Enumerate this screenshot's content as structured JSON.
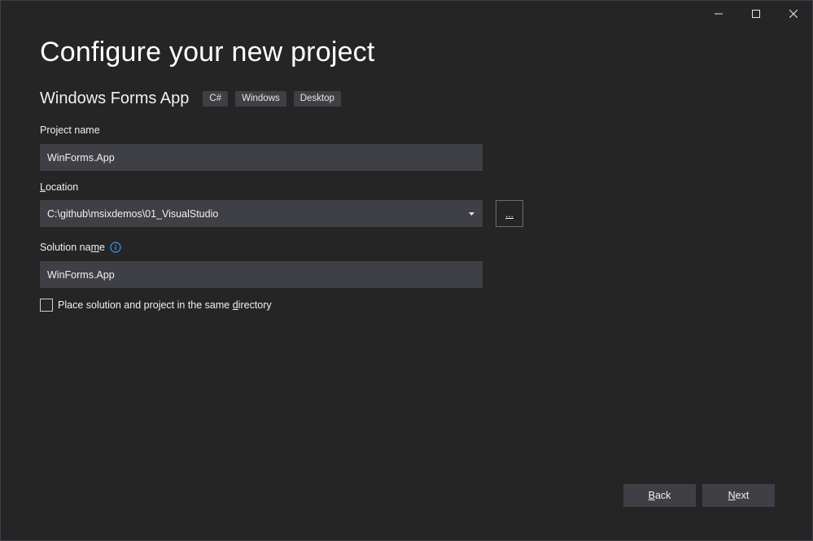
{
  "window": {
    "controls": [
      "minimize",
      "maximize",
      "close"
    ]
  },
  "header": {
    "title": "Configure your new project",
    "template_name": "Windows Forms App",
    "tags": [
      "C#",
      "Windows",
      "Desktop"
    ]
  },
  "form": {
    "project_name_label": "Project name",
    "project_name_value": "WinForms.App",
    "location_label_accel": "L",
    "location_label_rest": "ocation",
    "location_value": "C:\\github\\msixdemos\\01_VisualStudio",
    "browse_label": "...",
    "solution_name_label_pre": "Solution na",
    "solution_name_label_accel": "m",
    "solution_name_label_post": "e",
    "solution_name_value": "WinForms.App",
    "same_dir_label_pre": "Place solution and project in the same ",
    "same_dir_label_accel": "d",
    "same_dir_label_post": "irectory",
    "same_dir_checked": false
  },
  "footer": {
    "back_accel": "B",
    "back_rest": "ack",
    "next_accel": "N",
    "next_rest": "ext"
  },
  "colors": {
    "background": "#252526",
    "field": "#3f3f46",
    "info_icon": "#3794ff"
  }
}
